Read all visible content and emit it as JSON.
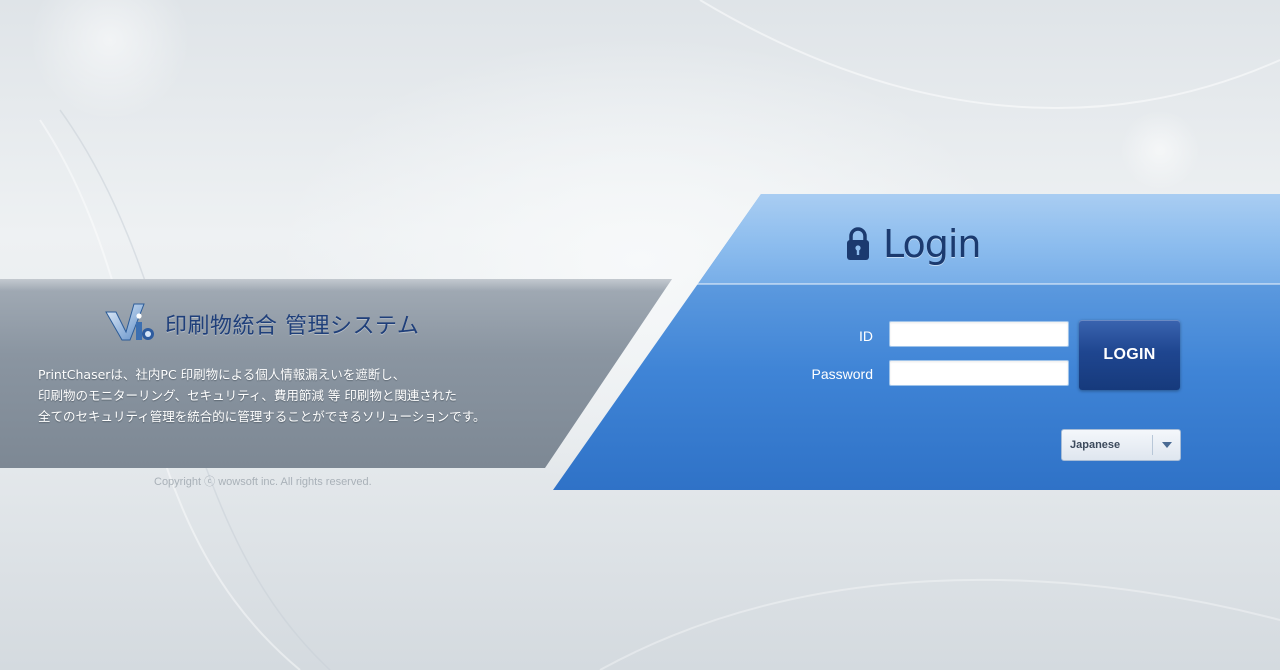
{
  "brand": {
    "title": "印刷物統合 管理システム",
    "logo_icon": "vi-logo-icon"
  },
  "description": {
    "lines": [
      "PrintChaserは、社内PC 印刷物による個人情報漏えいを遮断し、",
      "印刷物のモニターリング、セキュリティ、費用節減 等 印刷物と関連された",
      "全てのセキュリティ管理を統合的に管理することができるソリューションです。"
    ]
  },
  "copyright": "Copyright ⓒ wowsoft inc. All rights reserved.",
  "login": {
    "title": "Login",
    "lock_icon": "lock-icon",
    "id_label": "ID",
    "password_label": "Password",
    "id_value": "",
    "password_value": "",
    "button_label": "LOGIN",
    "language": {
      "selected": "Japanese",
      "arrow_icon": "chevron-down-icon"
    }
  },
  "colors": {
    "panel_blue": "#3f84d6",
    "button_navy": "#1f4690",
    "brand_title": "#1f3f7a"
  }
}
